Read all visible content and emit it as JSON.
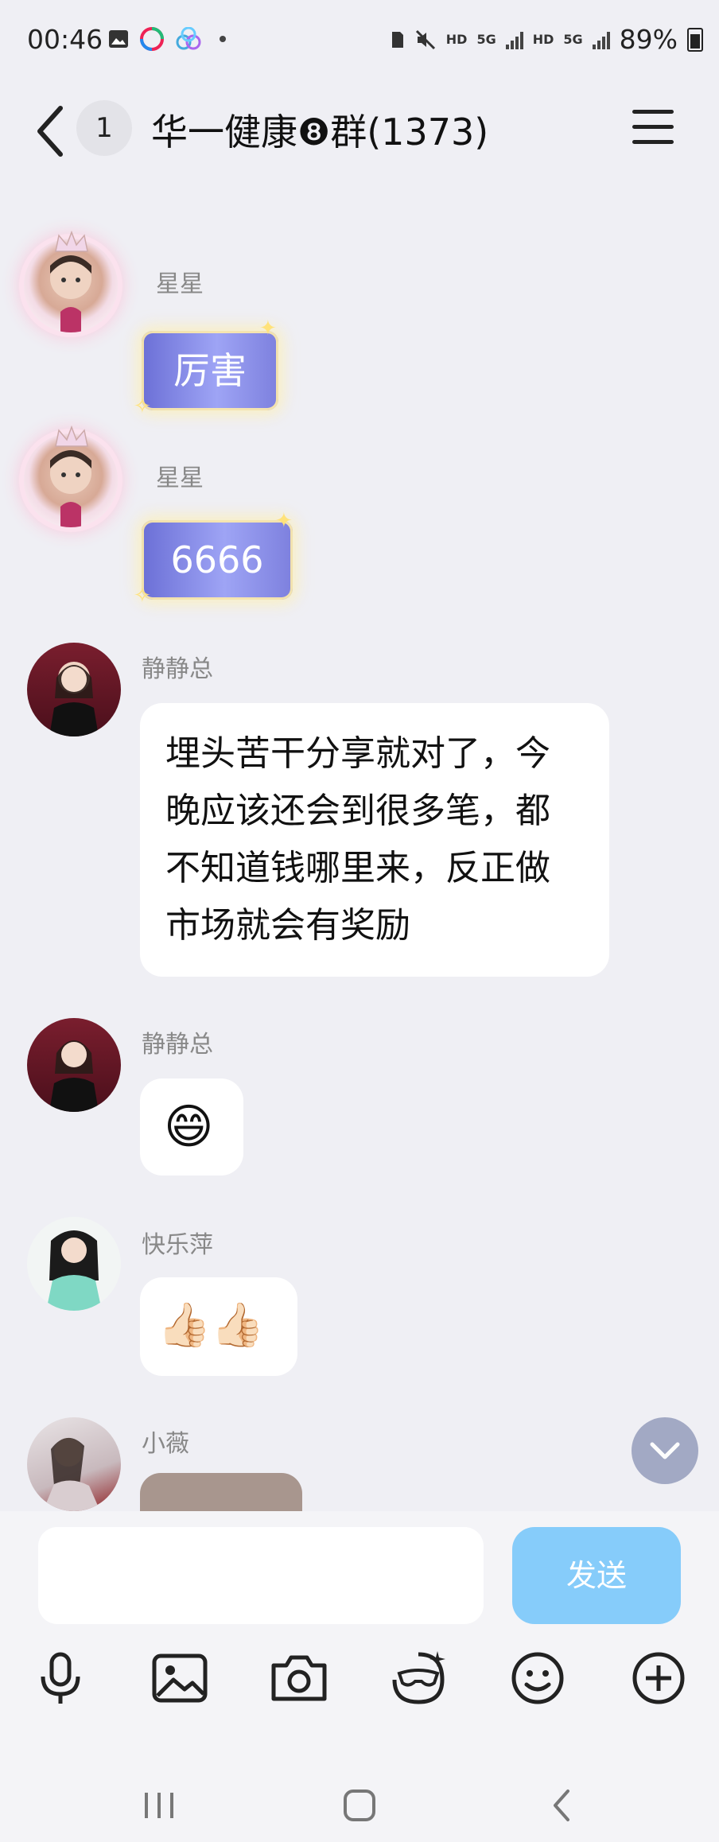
{
  "status_bar": {
    "time": "00:46",
    "battery": "89%",
    "left_icons": [
      "gallery-icon",
      "app-icon",
      "app-icon",
      "dot-icon"
    ],
    "right_icons": [
      "sim-icon",
      "mute-icon",
      "hd-icon",
      "5g-icon",
      "signal-icon",
      "hd-icon",
      "5g-icon",
      "signal-icon",
      "battery-icon"
    ],
    "hd_label": "HD",
    "net_label": "5G"
  },
  "header": {
    "back_icon": "chevron-left-icon",
    "unread_count": "1",
    "title": "华一健康❽群(1373)",
    "menu_icon": "hamburger-menu-icon"
  },
  "messages": [
    {
      "sender": "星星",
      "text": "厉害",
      "style": "decorated"
    },
    {
      "sender": "星星",
      "text": "6666",
      "style": "decorated"
    },
    {
      "sender": "静静总",
      "lines": [
        "埋头苦干分享就对了，今",
        "晚应该还会到很多笔，都",
        "不知道钱哪里来，反正做",
        "市场就会有奖励"
      ],
      "style": "text"
    },
    {
      "sender": "静静总",
      "text": "😄",
      "style": "emoji"
    },
    {
      "sender": "快乐萍",
      "text": "👍🏻👍🏻",
      "style": "emoji"
    },
    {
      "sender": "小薇",
      "style": "image"
    }
  ],
  "scroll_down_icon": "chevron-down-icon",
  "input": {
    "placeholder": "",
    "value": "",
    "send_label": "发送"
  },
  "toolbar": [
    "microphone-icon",
    "image-icon",
    "camera-icon",
    "sticker-icon",
    "emoji-icon",
    "plus-icon"
  ],
  "nav": [
    "recent-apps-icon",
    "home-icon",
    "back-icon"
  ],
  "colors": {
    "background": "#efeff4",
    "send_button": "#86ccfa",
    "bubble": "#ffffff",
    "deco_bubble": "#8a8ee8"
  }
}
